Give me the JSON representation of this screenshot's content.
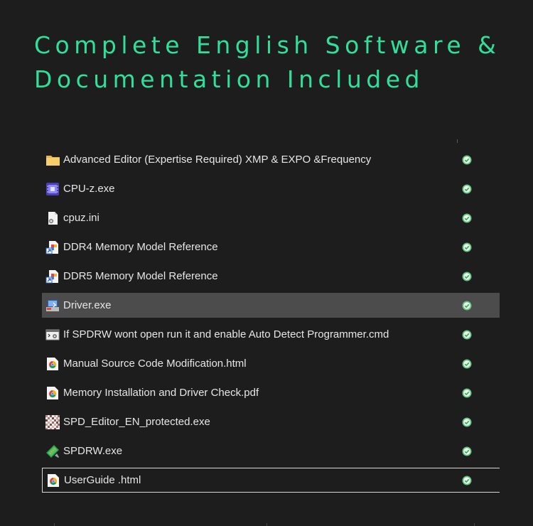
{
  "headline": {
    "line1": "Complete English Software &",
    "line2": "Documentation Included"
  },
  "files": [
    {
      "name": "Advanced Editor (Expertise Required) XMP & EXPO &Frequency",
      "icon": "folder-icon",
      "status": "check-icon"
    },
    {
      "name": "CPU-z.exe",
      "icon": "cpuz-app-icon",
      "status": "check-icon"
    },
    {
      "name": "cpuz.ini",
      "icon": "settings-file-icon",
      "status": "check-icon"
    },
    {
      "name": "DDR4 Memory Model Reference",
      "icon": "shortcut-icon",
      "status": "check-icon"
    },
    {
      "name": "DDR5 Memory Model Reference",
      "icon": "shortcut-icon",
      "status": "check-icon"
    },
    {
      "name": "Driver.exe",
      "icon": "installer-icon",
      "status": "check-icon",
      "selected": true
    },
    {
      "name": "If SPDRW wont open run it and enable Auto Detect Programmer.cmd",
      "icon": "cmd-script-icon",
      "status": "check-icon"
    },
    {
      "name": "Manual Source Code Modification.html",
      "icon": "chrome-icon",
      "status": "check-icon"
    },
    {
      "name": "Memory Installation and Driver Check.pdf",
      "icon": "chrome-icon",
      "status": "check-icon"
    },
    {
      "name": "SPD_Editor_EN_protected.exe",
      "icon": "pixelated-app-icon",
      "status": "check-icon"
    },
    {
      "name": "SPDRW.exe",
      "icon": "spdrw-app-icon",
      "status": "check-icon"
    },
    {
      "name": "UserGuide .html",
      "icon": "chrome-icon",
      "status": "check-icon",
      "focused": true
    }
  ],
  "colors": {
    "background": "#1d1d1d",
    "headline": "#2fe09a",
    "text": "#e6e6e6",
    "selected_row": "#4c4c4c",
    "status_ok": "#5ec47a"
  }
}
